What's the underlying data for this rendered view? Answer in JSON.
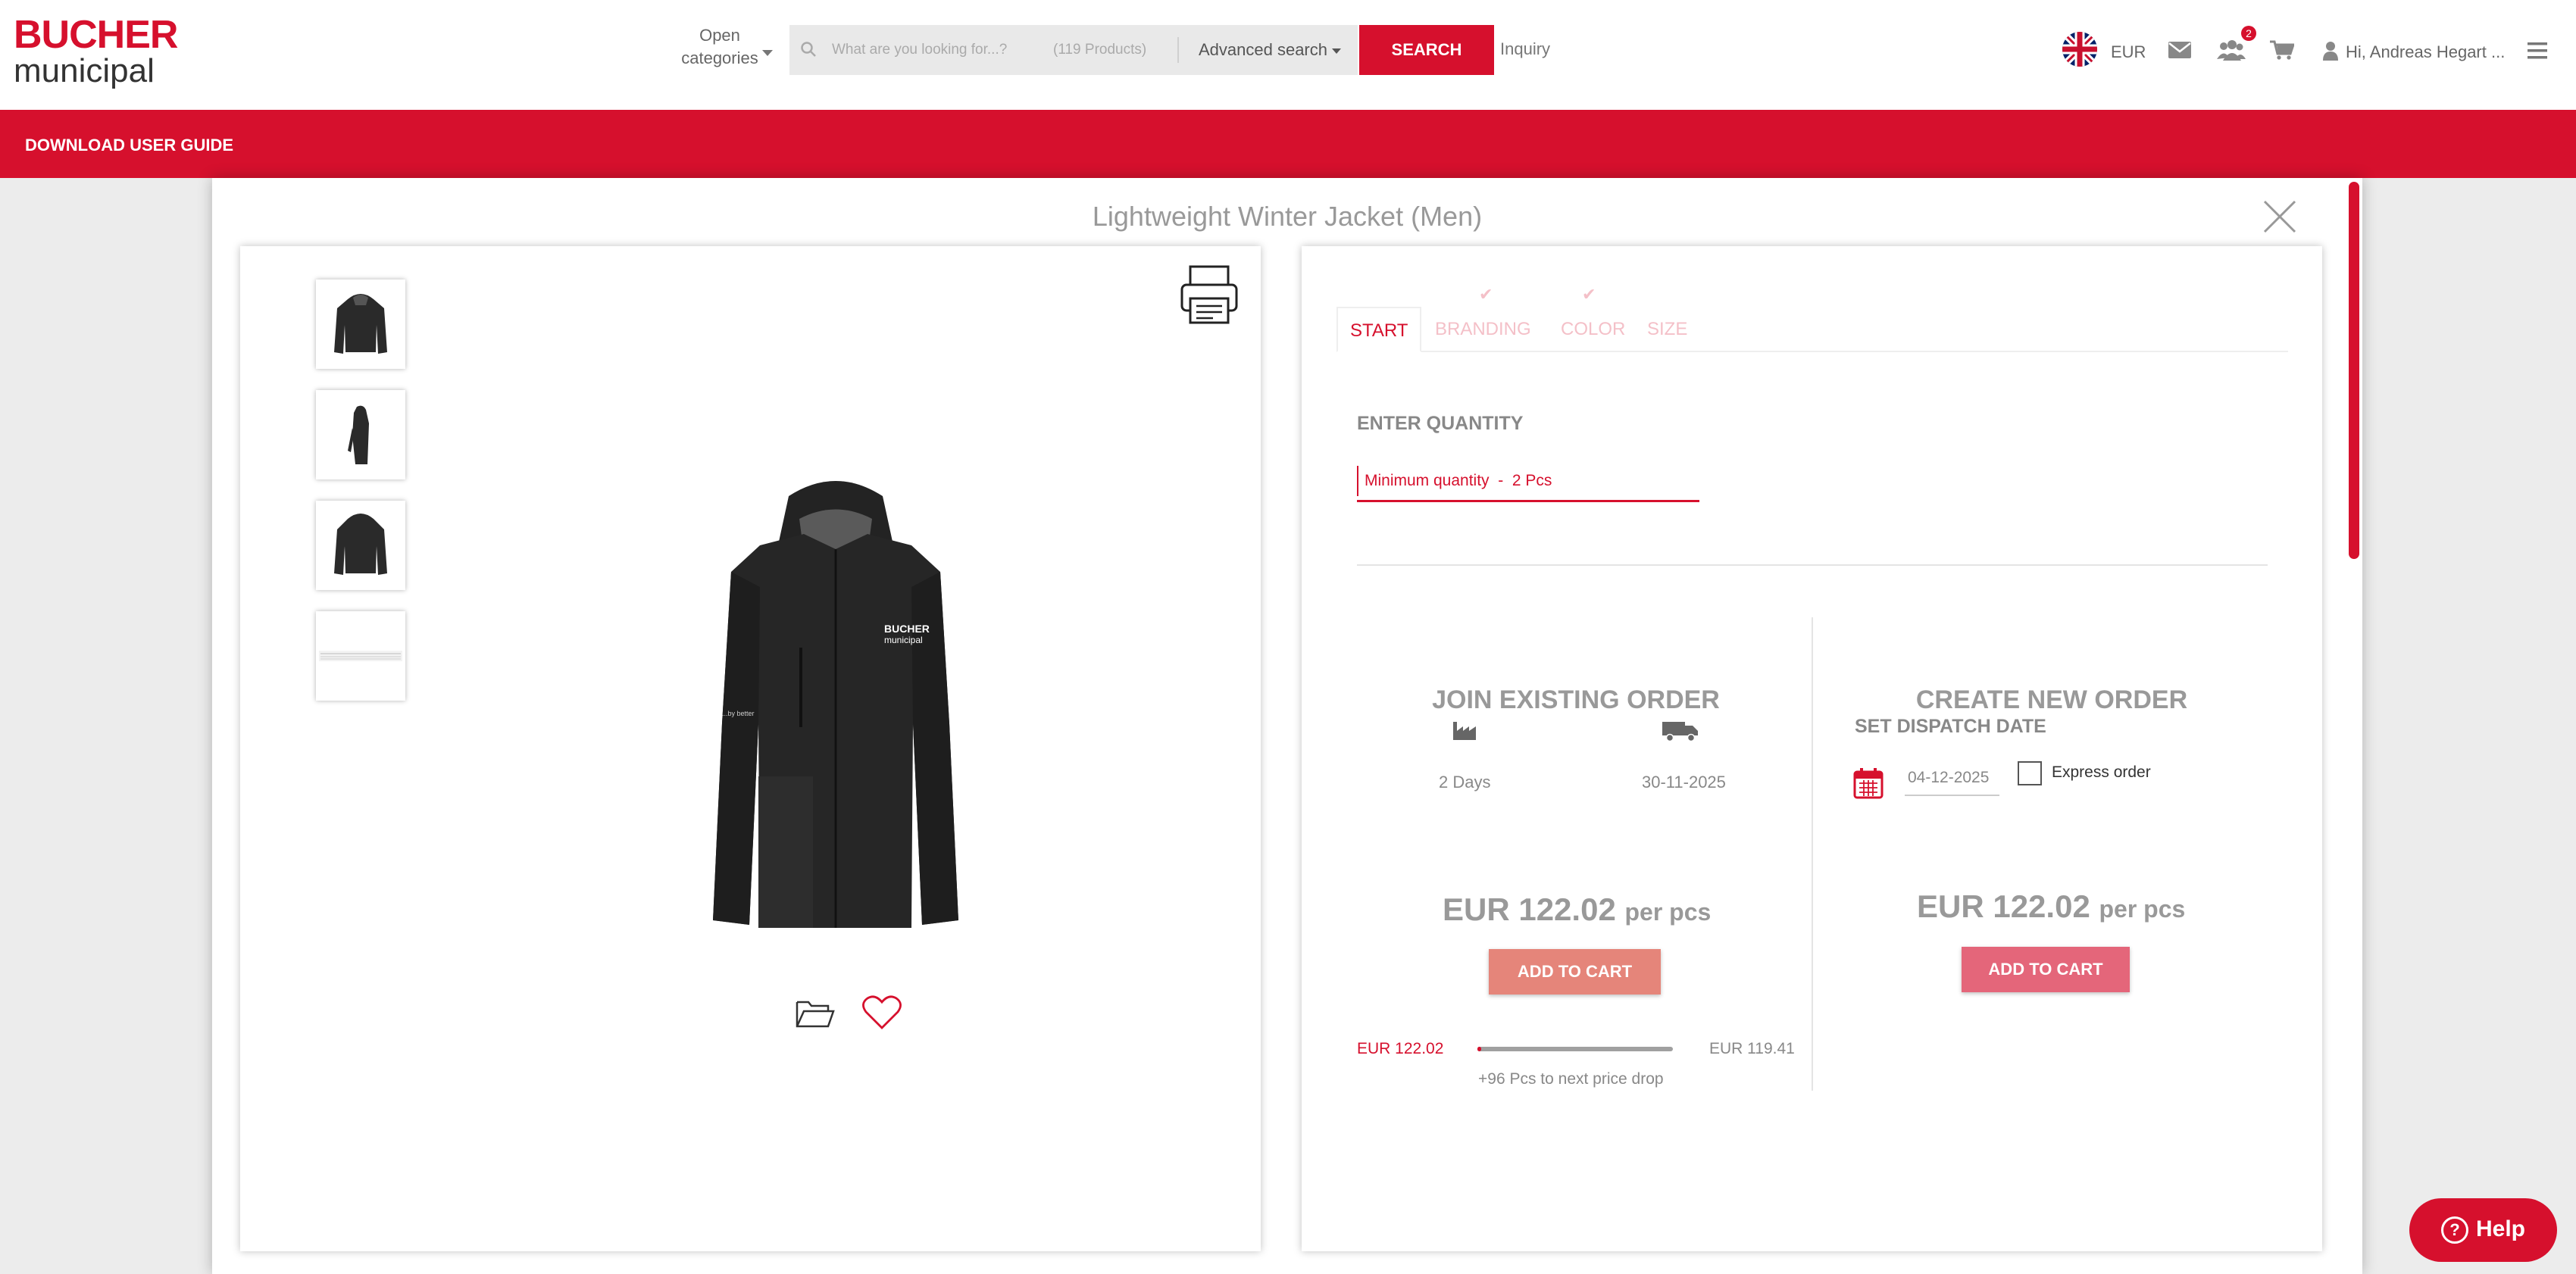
{
  "header": {
    "logo": {
      "brand": "BUCHER",
      "sub": "municipal"
    },
    "open_categories": "Open categories",
    "search": {
      "placeholder": "What are you looking for...?",
      "product_count": "(119 Products)",
      "advanced_label": "Advanced search",
      "button_label": "SEARCH"
    },
    "inquiry_label": "Inquiry",
    "currency": "EUR",
    "group_badge_count": "2",
    "user_greeting": "Hi, Andreas Hegart ...",
    "icons": [
      "uk-flag-icon",
      "mail-icon",
      "group-icon",
      "cart-icon",
      "user-icon",
      "menu-icon"
    ]
  },
  "banner": {
    "link_label": "DOWNLOAD USER GUIDE"
  },
  "modal": {
    "title": "Lightweight Winter Jacket (Men)",
    "gallery": {
      "thumbnails": [
        "jacket-front",
        "jacket-side",
        "jacket-back",
        "size-chart"
      ],
      "main_image": "jacket-front",
      "icons": [
        "printer-icon",
        "folder-icon",
        "heart-icon"
      ]
    },
    "tabs": [
      {
        "label": "START",
        "active": true,
        "checked": false
      },
      {
        "label": "BRANDING",
        "active": false,
        "checked": true
      },
      {
        "label": "COLOR",
        "active": false,
        "checked": true
      },
      {
        "label": "SIZE",
        "active": false,
        "checked": false
      }
    ],
    "quantity": {
      "label": "ENTER QUANTITY",
      "placeholder": "Minimum quantity  -  2 Pcs"
    },
    "join_existing": {
      "title": "JOIN EXISTING ORDER",
      "production_days": "2 Days",
      "delivery_date": "30-11-2025",
      "price": "EUR 122.02",
      "price_unit": "per pcs",
      "button_label": "ADD TO CART",
      "price_bar": {
        "current": "EUR 122.02",
        "next": "EUR 119.41",
        "progress": 0.02,
        "note": "+96 Pcs to next price drop"
      }
    },
    "create_new": {
      "title": "CREATE NEW ORDER",
      "dispatch_label": "SET DISPATCH DATE",
      "dispatch_date": "04-12-2025",
      "express_label": "Express order",
      "express_checked": false,
      "price": "EUR 122.02",
      "price_unit": "per pcs",
      "button_label": "ADD TO CART"
    }
  },
  "help": {
    "label": "Help"
  },
  "colors": {
    "brand_red": "#d6102d",
    "join_button": "#e5857a",
    "new_button": "#e4667a"
  }
}
